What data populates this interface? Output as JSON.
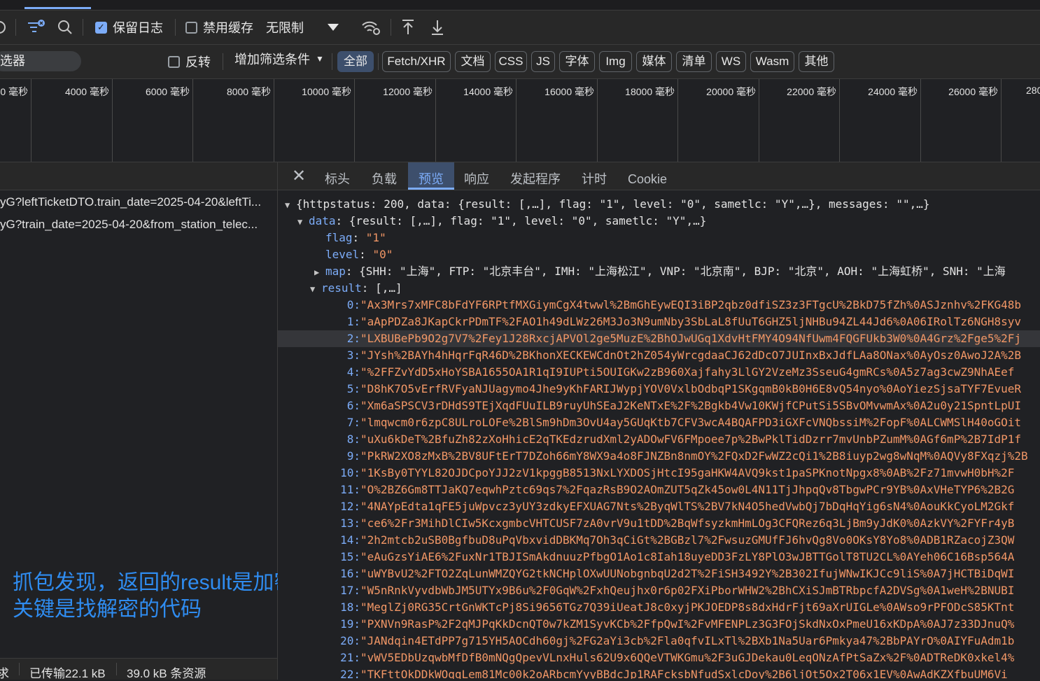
{
  "toolbar1": {
    "preserve_log": "保留日志",
    "disable_cache": "禁用缓存",
    "throttle": "无限制"
  },
  "toolbar2": {
    "filter_placeholder": "选器",
    "invert": "反转",
    "more_filters": "增加筛选条件",
    "types": [
      "全部",
      "Fetch/XHR",
      "文档",
      "CSS",
      "JS",
      "字体",
      "Img",
      "媒体",
      "清单",
      "WS",
      "Wasm",
      "其他"
    ]
  },
  "timeline": {
    "ticks": [
      "0 毫秒",
      "4000 毫秒",
      "6000 毫秒",
      "8000 毫秒",
      "10000 毫秒",
      "12000 毫秒",
      "14000 毫秒",
      "16000 毫秒",
      "18000 毫秒",
      "20000 毫秒",
      "22000 毫秒",
      "24000 毫秒",
      "26000 毫秒",
      "280"
    ]
  },
  "requests": [
    "yG?leftTicketDTO.train_date=2025-04-20&leftTi...",
    "yG?train_date=2025-04-20&from_station_telec..."
  ],
  "annotation": {
    "line1": "抓包发现，返回的result是加密的。",
    "line2": "关键是找解密的代码"
  },
  "statusbar": {
    "requests": "求",
    "transferred": "已传输22.1 kB",
    "resources": "39.0 kB 条资源"
  },
  "detail_tabs": [
    "标头",
    "负载",
    "预览",
    "响应",
    "发起程序",
    "计时",
    "Cookie"
  ],
  "preview": {
    "root": "{httpstatus: 200, data: {result: [,…], flag: \"1\", level: \"0\", sametlc: \"Y\",…}, messages: \"\",…}",
    "data_key": "data",
    "data_summary": "{result: [,…], flag: \"1\", level: \"0\", sametlc: \"Y\",…}",
    "flag_key": "flag",
    "flag_val": "\"1\"",
    "level_key": "level",
    "level_val": "\"0\"",
    "map_key": "map",
    "map_val": "{SHH: \"上海\", FTP: \"北京丰台\", IMH: \"上海松江\", VNP: \"北京南\", BJP: \"北京\", AOH: \"上海虹桥\", SNH: \"上海",
    "result_key": "result",
    "result_summary": "[,…]",
    "results": [
      "\"Ax3Mrs7xMFC8bFdYF6RPtfMXGiymCgX4twwl%2BmGhEywEQI3iBP2qbz0dfiSZ3z3FTgcU%2BkD75fZh%0ASJznhv%2FKG48b",
      "\"aApPDZa8JKapCkrPDmTF%2FAO1h49dLWz26M3Jo3N9umNby3SbLaL8fUuT6GHZ5ljNHBu94ZL44Jd6%0A06IRolTz6NGH8syv",
      "\"LXBUBePb9O2g7V7%2Fey1J28RxcjAPVOl2ge5MuzE%2BhOJwUGq1XdvHtFMY4O94NfUwm4FQGFUkb3W0%0A4Grz%2Fge5%2Fj",
      "\"JYsh%2BAYh4hHqrFqR46D%2BKhonXECKEWCdnOt2hZ054yWrcgdaaCJ62dDcO7JUInxBxJdfLAa8ONax%0AyOsz0AwoJ2A%2B",
      "\"%2FFZvYdD5xHoYSBA1655OA1R1qI9IUPti5OUIGKw2zB960Xajfahy3LlGY2VzeMz3SseuG4gmRCs%0A5z7ag3cwZ9NhAEef",
      "\"D8hK7O5vErfRVFyaNJUagymo4Jhe9yKhFARIJWypjYOV0VxlbOdbqP1SKgqmB0kB0H6E8vQ54nyo%0AoYiezSjsaTYF7EvueR",
      "\"Xm6aSPSCV3rDHdS9TEjXqdFUuILB9ruyUhSEaJ2KeNTxE%2F%2Bgkb4Vw10KWjfCPutSi5SBvOMvwmAx%0A2u0y21SpntLpUI",
      "\"lmqwcm0r6zpC8ULroLOFe%2BlSm9hDm3OvU4ay5GUqKtb7CFV3wcA4BQAFPD3iGXFcVNQbssiM%2FopF%0ALCWMSlH40oGOit",
      "\"uXu6kDeT%2BfuZh82zXoHhicE2qTKEdzrudXml2yADOwFV6FMpoee7p%2BwPklTidDzrr7mvUnbPZumM%0AGf6mP%2B7IdP1f",
      "\"PkRW2XO8zMxB%2BV8UFtErT7DZoh66mY8WX9a4o8FJNZBn8nmOY%2FQxD2FwWZ2cQi1%2B8iuyp2wg8wNqM%0AQVy8FXqzj%2B",
      "\"1KsBy0TYYL82OJDCpoYJJ2zV1kpggB8513NxLYXDOSjHtcI95gaHKW4AVQ9kst1paSPKnotNpgx8%0AB%2Fz71mvwH0bH%2F",
      "\"O%2BZ6Gm8TTJaKQ7eqwhPztc69qs7%2FqazRsB9O2AOmZUT5qZk45ow0L4N11TjJhpqQv8TbgwPCr9YB%0AxVHeTYP6%2B2G",
      "\"4NAYpEdta1qFE5juWpvcz3yUY3zdkyEFXUAG7Nts%2ByqWlTS%2BV7kN4O5hedVwbQj7bDqHqYig6sN4%0AouKkCyoLM2Gkf",
      "\"ce6%2Fr3MihDlCIw5KcxgmbcVHTCUSF7zA0vrV9u1tDD%2BqWfsyzkmHmLOg3CFQRez6q3LjBm9yJdK0%0AzkVY%2FYFr4yB",
      "\"2h2mtcb2uSB0BgfbuD8uPqVbxvidDBKMq7Oh3qCiGt%2BGBzl7%2FwsuzGMUfFJ6hvQg8Vo0OKsY8Yo8%0ADB1RZacojZ3QW",
      "\"eAuGzsYiAE6%2FuxNr1TBJISmAkdnuuzPfbgO1Ao1c8Iah18uyeDD3FzLY8PlO3wJBTTGolT8TU2CL%0AYeh06C16Bsp564A",
      "\"uWYBvU2%2FTO2ZqLunWMZQYG2tkNCHplOXwUUNobgnbqU2d2T%2FiSH3492Y%2B302IfujWNwIKJCc9liS%0A7jHCTBiDqWI",
      "\"W5nRnkVyvdbWbJM5UTYx9B6u%2F0GqW%2FxhQeujhx0r6p02FXiPborWHW2%2BhCXiSJmBTRbpcfA2DVSg%0A1weH%2BNUBI",
      "\"MeglZj0RG35CrtGnWKTcPj8Si9656TGz7Q39iUeatJ8c0xyjPKJOEDP8s8dxHdrFjt69aXrUIGLe%0AWso9rPFODcS85KTnt",
      "\"PXNVn9RasP%2F2qMJPqKkDcnQT0w7kZM1SyvKCb%2FfpQwI%2FvMFENPLz3G3FOjSkdNxOxPmeU16xKDpA%0AJ7z33DJnuQ%",
      "\"JANdqin4ETdPP7g715YH5AOCdh60gj%2FG2aYi3cb%2Fla0qfvILxTl%2BXb1Na5Uar6Pmkya47%2BbPAYrO%0AIYFuAdm1b",
      "\"vWV5EDbUzqwbMfDfB0mNQgQpevVLnxHuls62U9x6QQeVTWKGmu%2F3uGJDekau0LeqONzAfPtSaZx%2F%0ADTReDK0xkel4%",
      "\"TKFttOkDDkWOqqLem81Mc00k2oARbcmYyyBBdcJp1RAFcksbNfudSxlcDoy%2B6ljOt5Ox2T06x1EV%0AwAdKZXfbuUM6Vi"
    ]
  }
}
